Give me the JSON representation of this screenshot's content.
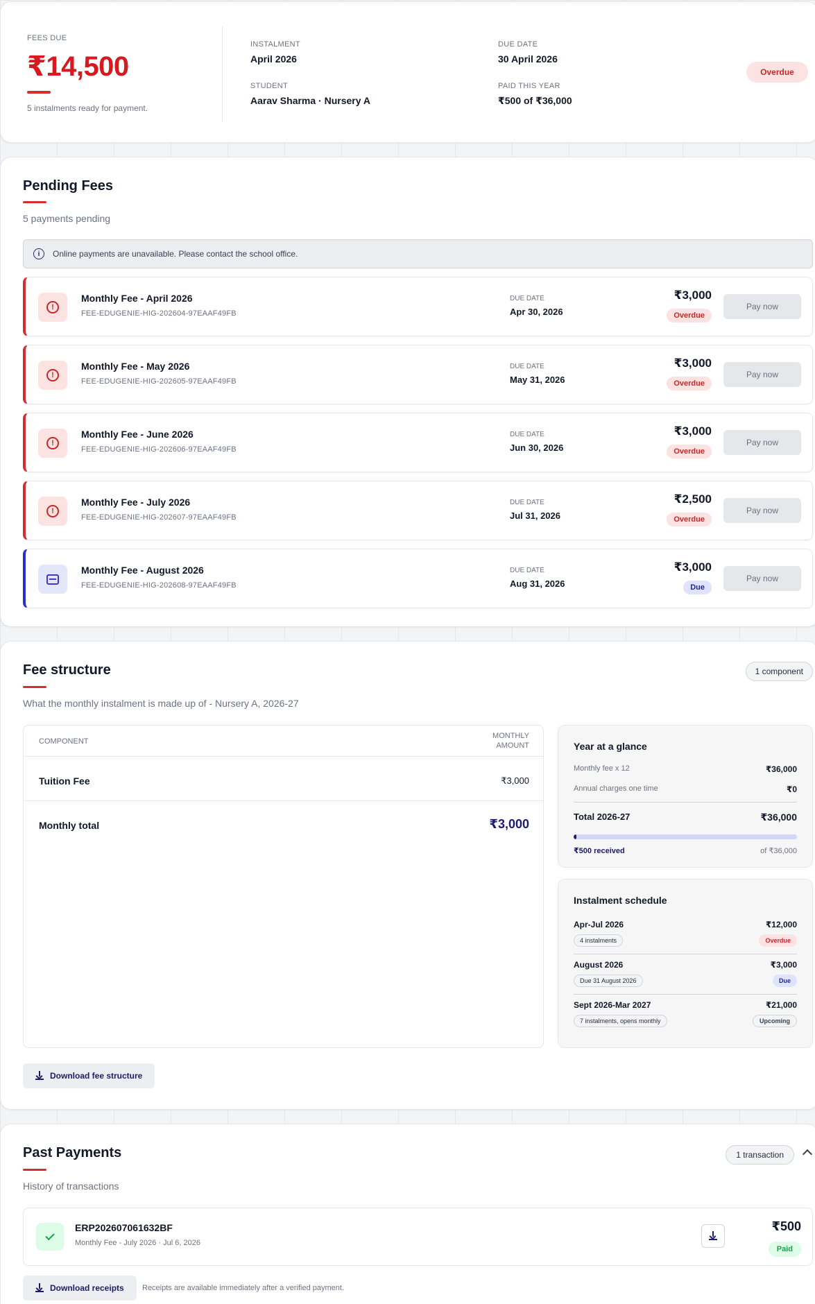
{
  "summary": {
    "fees_due_label": "FEES DUE",
    "fees_due_amount": "₹14,500",
    "note": "5 instalments ready for payment.",
    "instalment_label": "INSTALMENT",
    "instalment_value": "April 2026",
    "student_label": "STUDENT",
    "student_value": "Aarav Sharma · Nursery A",
    "due_date_label": "DUE DATE",
    "due_date_value": "30 April 2026",
    "paid_label": "PAID THIS YEAR",
    "paid_value": "₹500 of ₹36,000",
    "status": "Overdue"
  },
  "pending": {
    "title": "Pending Fees",
    "subtitle": "5 payments pending",
    "notice": "Online payments are unavailable. Please contact the school office.",
    "notice_icon": "i",
    "alert_icon": "!",
    "due_label": "DUE DATE",
    "pay_label": "Pay now",
    "items": [
      {
        "name": "Monthly Fee - April 2026",
        "ref": "FEE-EDUGENIE-HIG-202604-97EAAF49FB",
        "due": "Apr 30, 2026",
        "amount": "₹3,000",
        "status": "Overdue"
      },
      {
        "name": "Monthly Fee - May 2026",
        "ref": "FEE-EDUGENIE-HIG-202605-97EAAF49FB",
        "due": "May 31, 2026",
        "amount": "₹3,000",
        "status": "Overdue"
      },
      {
        "name": "Monthly Fee - June 2026",
        "ref": "FEE-EDUGENIE-HIG-202606-97EAAF49FB",
        "due": "Jun 30, 2026",
        "amount": "₹3,000",
        "status": "Overdue"
      },
      {
        "name": "Monthly Fee - July 2026",
        "ref": "FEE-EDUGENIE-HIG-202607-97EAAF49FB",
        "due": "Jul 31, 2026",
        "amount": "₹2,500",
        "status": "Overdue"
      },
      {
        "name": "Monthly Fee - August 2026",
        "ref": "FEE-EDUGENIE-HIG-202608-97EAAF49FB",
        "due": "Aug 31, 2026",
        "amount": "₹3,000",
        "status": "Due"
      }
    ]
  },
  "structure": {
    "title": "Fee structure",
    "subtitle": "What the monthly instalment is made up of - Nursery A, 2026-27",
    "component_count": "1 component",
    "table": {
      "col_component": "COMPONENT",
      "col_amount": "MONTHLY AMOUNT",
      "row_name": "Tuition Fee",
      "row_amount": "₹3,000",
      "total_label": "Monthly total",
      "total_amount": "₹3,000"
    },
    "glance": {
      "title": "Year at a glance",
      "monthly_label": "Monthly fee x 12",
      "monthly_value": "₹36,000",
      "annual_label": "Annual charges one time",
      "annual_value": "₹0",
      "total_label": "Total 2026-27",
      "total_value": "₹36,000",
      "received": "₹500 received",
      "of_total": "of ₹36,000",
      "progress_fraction": 0.0139
    },
    "schedule": {
      "title": "Instalment schedule",
      "items": [
        {
          "name": "Apr-Jul 2026",
          "amount": "₹12,000",
          "sub": "4 instalments",
          "status": "Overdue"
        },
        {
          "name": "August 2026",
          "amount": "₹3,000",
          "sub": "Due 31 August 2026",
          "status": "Due"
        },
        {
          "name": "Sept 2026-Mar 2027",
          "amount": "₹21,000",
          "sub": "7 instalments, opens monthly",
          "status": "Upcoming"
        }
      ]
    },
    "download_label": "Download fee structure"
  },
  "past": {
    "title": "Past Payments",
    "subtitle": "History of transactions",
    "count": "1 transaction",
    "transaction": {
      "id": "ERP202607061632BF",
      "desc": "Monthly Fee - July 2026 · Jul 6, 2026",
      "amount": "₹500",
      "status": "Paid"
    },
    "download_label": "Download receipts",
    "note": "Receipts are available immediately after a verified payment."
  },
  "colors": {
    "accent_red": "#d32f2f",
    "amount_red": "#d71920",
    "navy": "#1e1b6b",
    "due_blue": "#2b2fc7",
    "paid_green": "#16a34a"
  },
  "icons": {
    "notice": "info-icon",
    "overdue_fee": "alert-circle-icon",
    "due_fee": "wallet-icon",
    "download": "download-icon",
    "paid": "check-icon",
    "collapse": "chevron-up-icon"
  }
}
